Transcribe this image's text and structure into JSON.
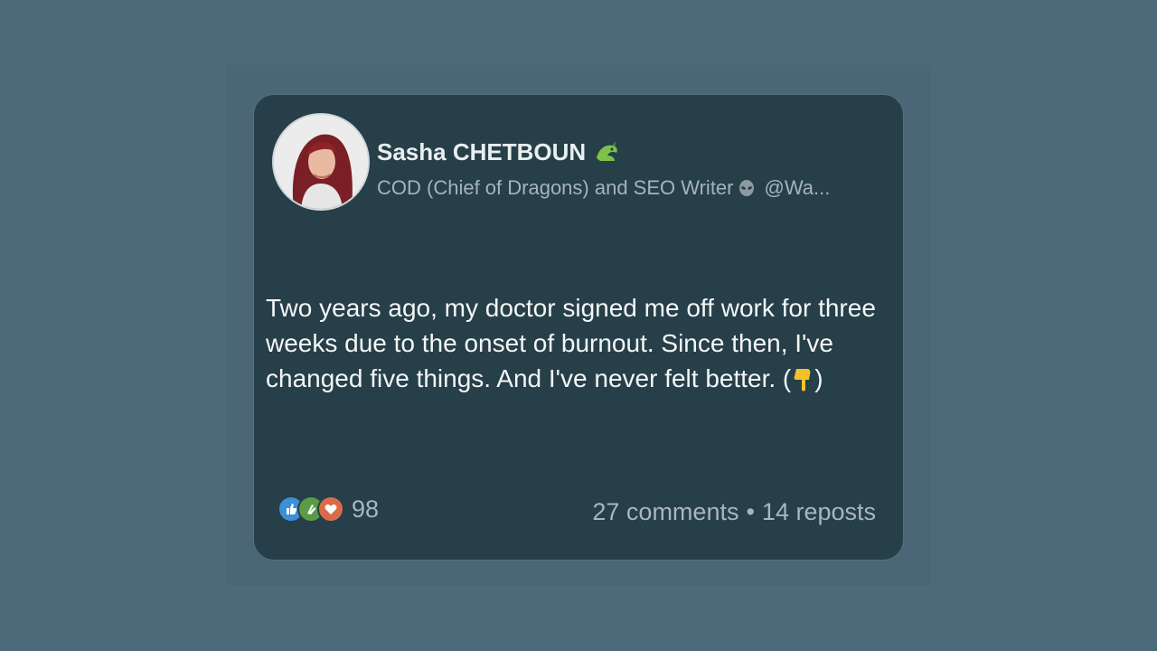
{
  "post": {
    "author_name": "Sasha CHETBOUN",
    "author_headline": "COD (Chief of Dragons) and SEO Writer",
    "author_handle": "@Wa...",
    "text": "Two years ago, my doctor signed me off work for three weeks due to the onset of burnout. Since then, I've changed five things. And I've never felt better. (",
    "text_end": ")",
    "icons": {
      "name_suffix": "dragon-icon",
      "headline_suffix": "alien-icon",
      "text_suffix": "point-down-icon"
    }
  },
  "stats": {
    "reaction_count": "98",
    "reactions": [
      "like-icon",
      "clap-icon",
      "love-icon"
    ],
    "comments": "27 comments",
    "separator": "•",
    "reposts": "14 reposts"
  }
}
